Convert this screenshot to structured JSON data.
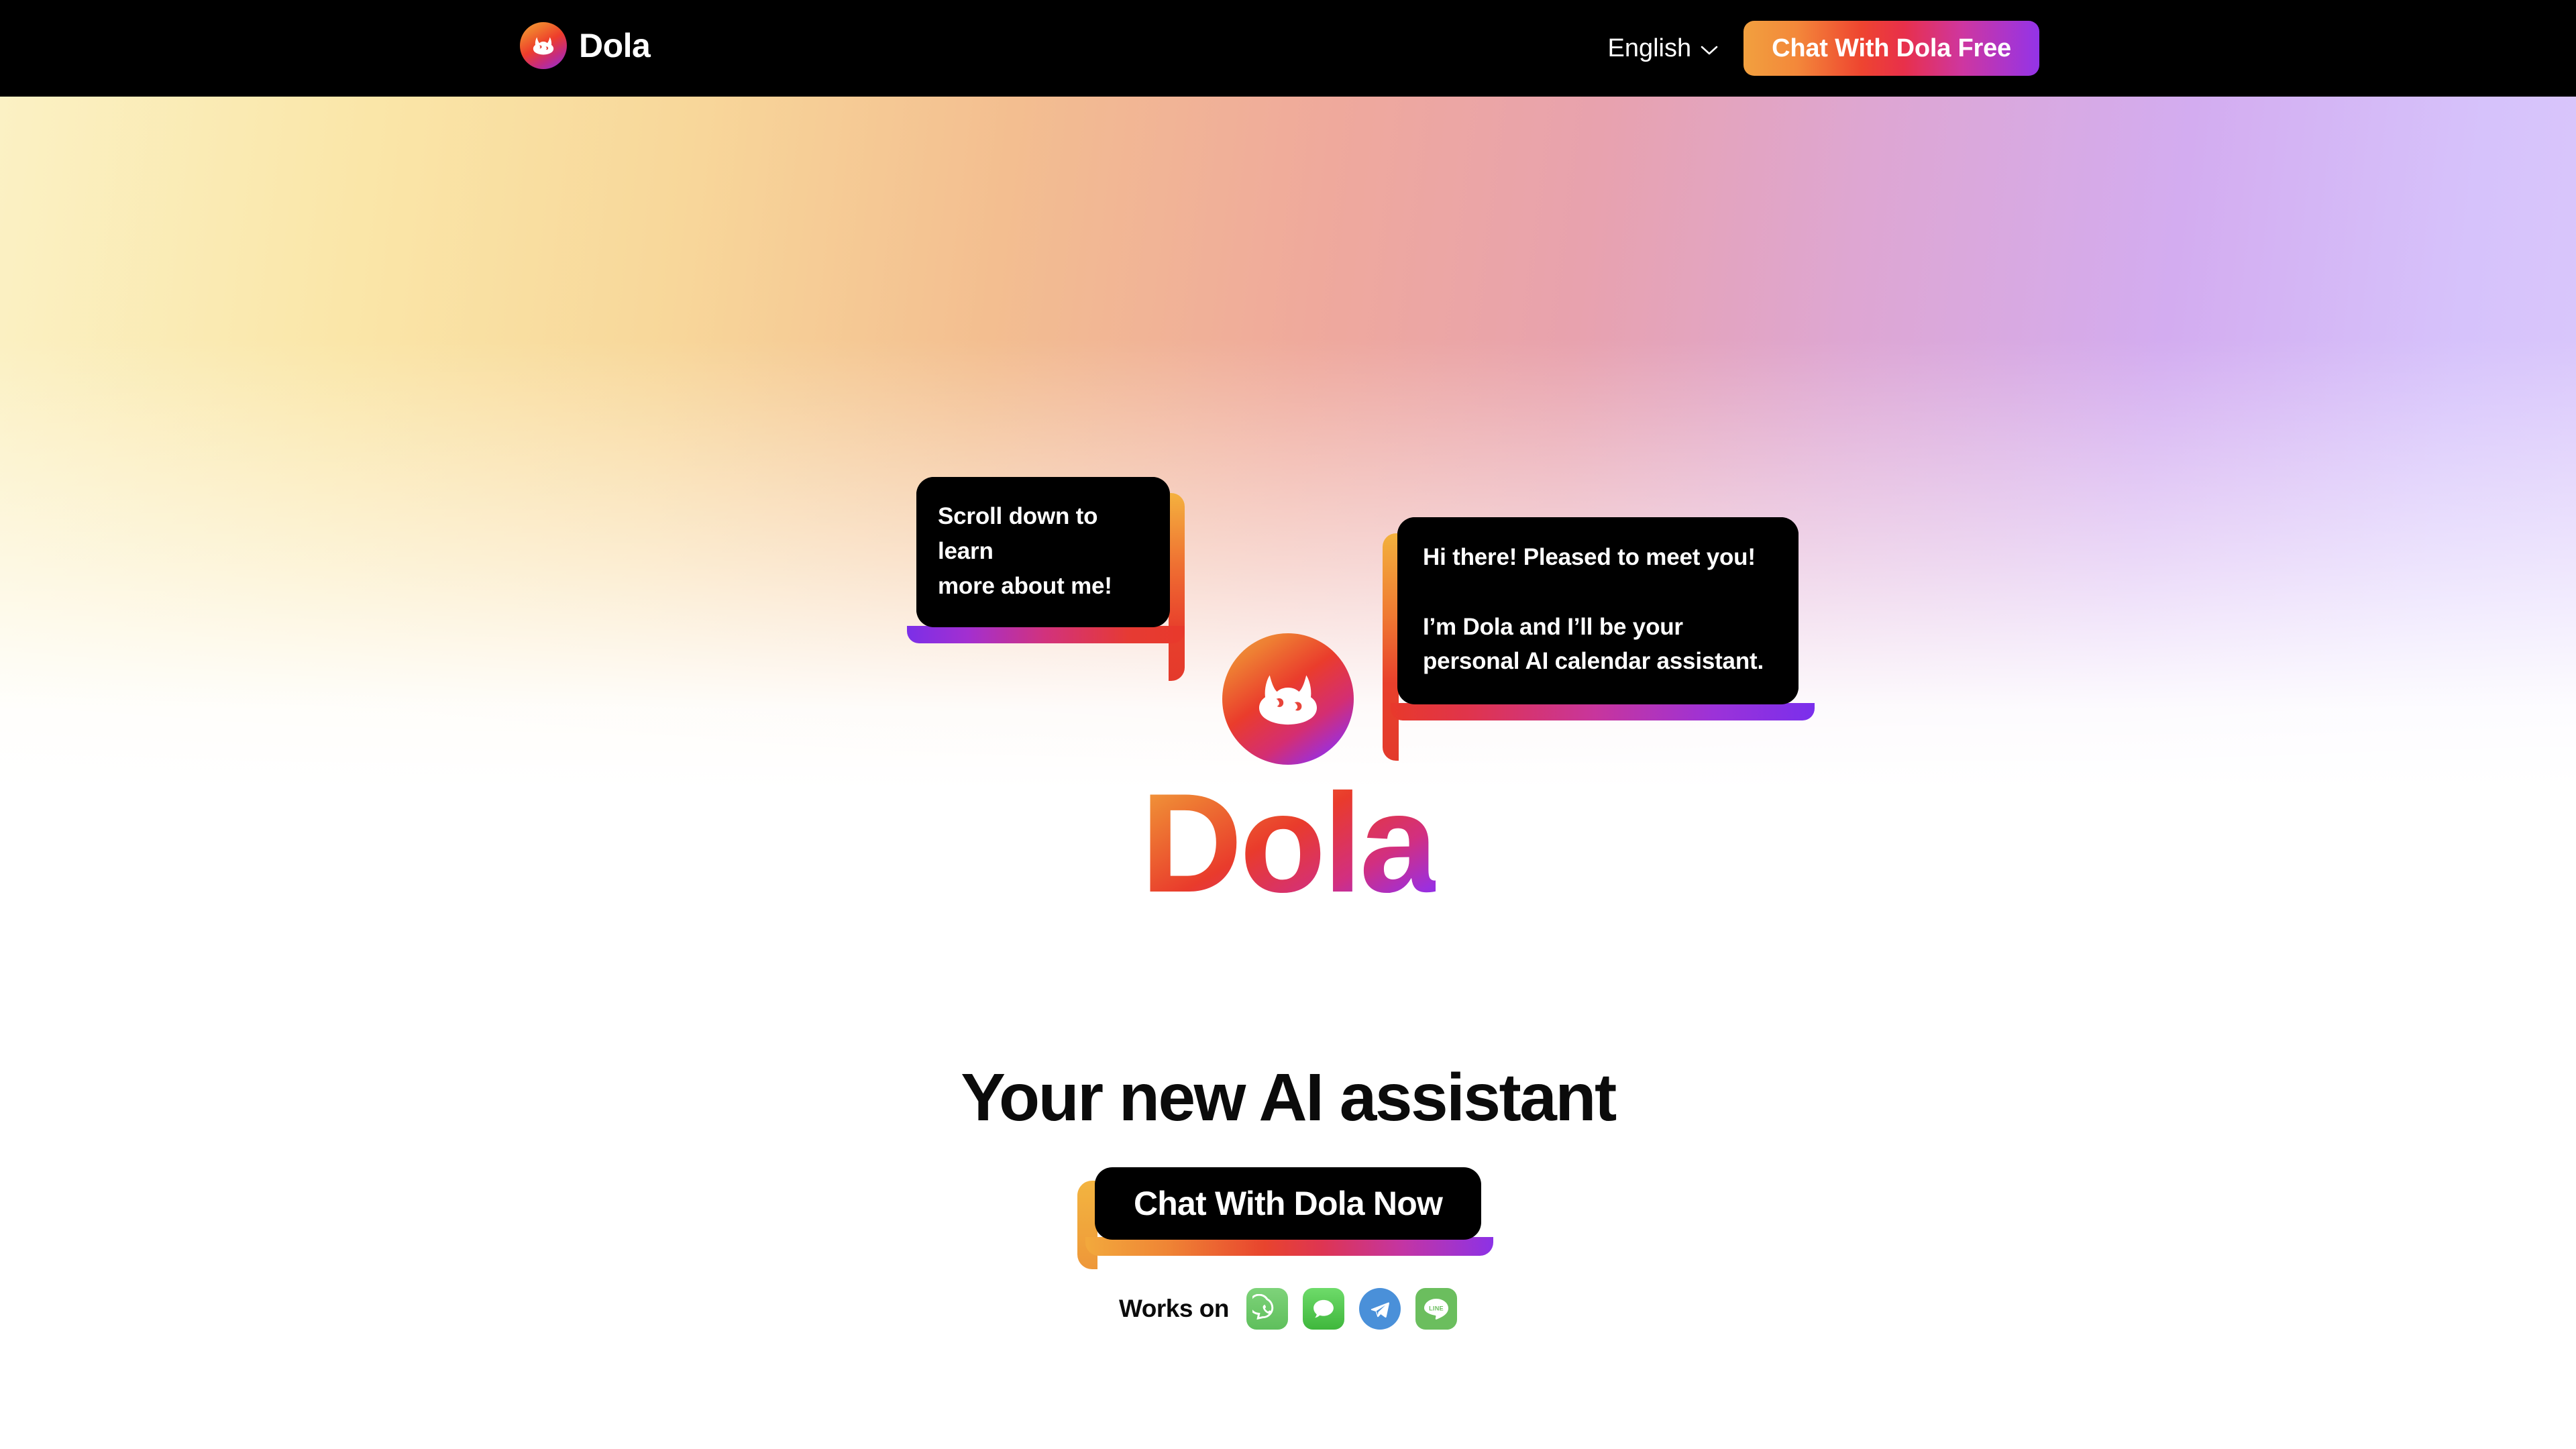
{
  "header": {
    "brand_name": "Dola",
    "brand_icon": "dola-cat-logo-icon",
    "language_label": "English",
    "language_chevron_icon": "chevron-down-icon",
    "cta_label": "Chat With Dola Free",
    "background_color": "#000000"
  },
  "hero": {
    "bubble_left": {
      "text": "Scroll down to learn\nmore about me!"
    },
    "bubble_right": {
      "text": "Hi there! Pleased to meet you!\n\nI’m Dola and I’ll be your\npersonal AI calendar assistant."
    },
    "logo_icon": "dola-cat-logo-icon",
    "logo_wordmark": "Dola",
    "headline": "Your new AI assistant",
    "cta_label": "Chat With Dola Now",
    "works_on_label": "Works on",
    "works_on_apps": [
      {
        "name": "WhatsApp",
        "icon": "whatsapp-icon",
        "color": "#5FBF5C"
      },
      {
        "name": "iMessage",
        "icon": "imessage-icon",
        "color": "#3FB73C"
      },
      {
        "name": "Telegram",
        "icon": "telegram-icon",
        "color": "#4A90D9"
      },
      {
        "name": "LINE",
        "icon": "line-icon",
        "color": "#6BBE5E",
        "glyph_text": "LINE"
      }
    ]
  },
  "theme": {
    "gradient_start": "#FBF1C4",
    "gradient_mid": "#EFA99C",
    "gradient_end": "#DAC8FB",
    "brand_orange": "#F2A43E",
    "brand_red": "#E93B2C",
    "brand_magenta": "#D22F80",
    "brand_purple": "#7C2FF0",
    "page_background": "#FFFFFF",
    "ink": "#0B0B0B"
  }
}
